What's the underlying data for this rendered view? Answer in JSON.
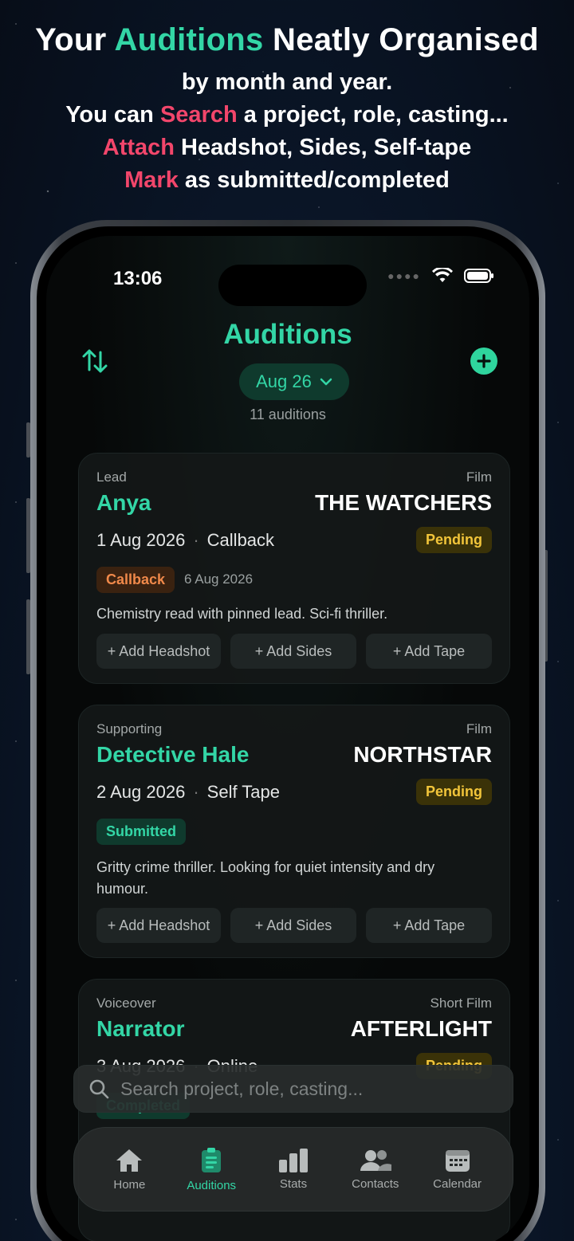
{
  "promo": {
    "title_pre": "Your",
    "title_accent": "Auditions",
    "title_post": "Neatly Organised",
    "line1": "by month and year.",
    "line2_pre": "You can",
    "line2_accent": "Search",
    "line2_post": "a project, role, casting...",
    "line3_accent": "Attach",
    "line3_post": "Headshot, Sides, Self-tape",
    "line4_accent": "Mark",
    "line4_post": "as submitted/completed"
  },
  "status_bar": {
    "time": "13:06"
  },
  "header": {
    "title": "Auditions",
    "month": "Aug 26",
    "count": "11 auditions"
  },
  "auditions": [
    {
      "role_type": "Lead",
      "project_type": "Film",
      "role": "Anya",
      "project": "THE WATCHERS",
      "date": "1 Aug 2026",
      "kind": "Callback",
      "status": "Pending",
      "tag": "Callback",
      "tag_date": "6 Aug 2026",
      "notes": "Chemistry read with pinned lead. Sci-fi thriller."
    },
    {
      "role_type": "Supporting",
      "project_type": "Film",
      "role": "Detective Hale",
      "project": "NORTHSTAR",
      "date": "2 Aug 2026",
      "kind": "Self Tape",
      "status": "Pending",
      "tag": "Submitted",
      "notes": "Gritty crime thriller. Looking for quiet intensity and dry humour."
    },
    {
      "role_type": "Voiceover",
      "project_type": "Short Film",
      "role": "Narrator",
      "project": "AFTERLIGHT",
      "date": "3 Aug 2026",
      "kind": "Online",
      "status": "Pending",
      "tag": "Completed"
    }
  ],
  "actions": {
    "headshot": "+ Add Headshot",
    "sides": "+ Add Sides",
    "tape": "+ Add Tape"
  },
  "search": {
    "placeholder": "Search project, role, casting..."
  },
  "tabs": [
    {
      "label": "Home",
      "icon": "home-icon"
    },
    {
      "label": "Auditions",
      "icon": "clipboard-icon",
      "active": true
    },
    {
      "label": "Stats",
      "icon": "bar-chart-icon"
    },
    {
      "label": "Contacts",
      "icon": "people-icon"
    },
    {
      "label": "Calendar",
      "icon": "calendar-icon"
    }
  ],
  "colors": {
    "accent": "#33d6a6",
    "pink": "#f2466b",
    "pending": "#f2c53a",
    "callback": "#f0894a"
  }
}
